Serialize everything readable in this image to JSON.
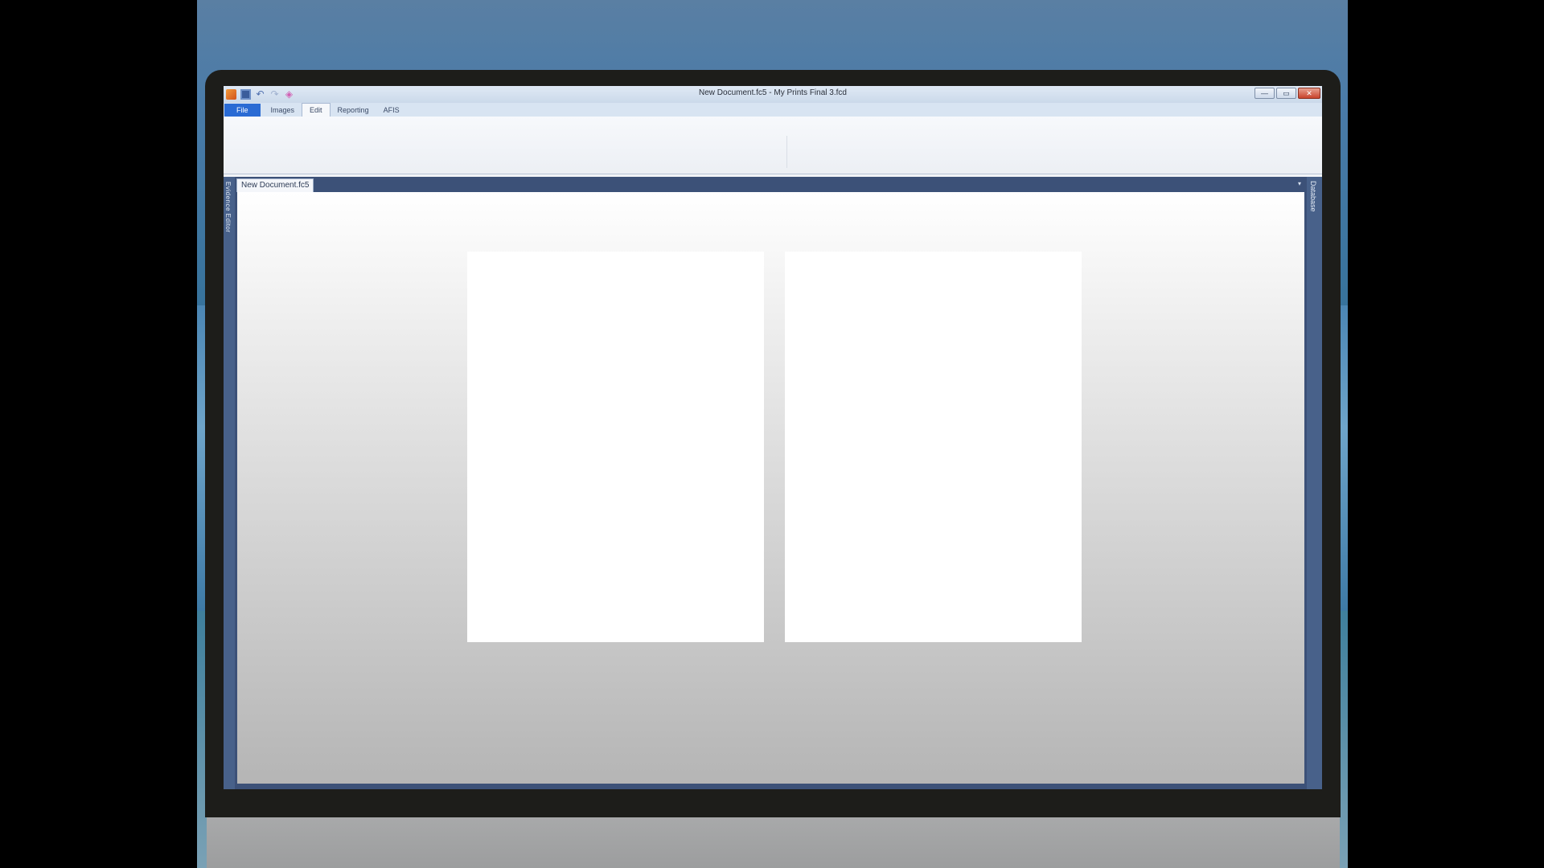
{
  "window": {
    "title": "New Document.fc5 - My Prints Final 3.fcd",
    "controls": {
      "minimize": "—",
      "maximize": "▭",
      "close": "✕"
    }
  },
  "quick_access": {
    "icons": [
      "app-icon",
      "save-icon",
      "undo-icon",
      "redo-icon",
      "extra-icon"
    ],
    "undo_glyph": "↶",
    "redo_glyph": "↷",
    "extra_glyph": "◈"
  },
  "ribbon_tabs": [
    {
      "label": "File"
    },
    {
      "label": "Images"
    },
    {
      "label": "Edit"
    },
    {
      "label": "Reporting"
    },
    {
      "label": "AFIS"
    }
  ],
  "active_tab": "Edit",
  "document": {
    "tab_label": "New Document.fc5",
    "dropdown_glyph": "▾"
  },
  "side_panels": {
    "left_label": "Evidence Editor",
    "right_label": "Database"
  },
  "colors": {
    "file_tab": "#2a6bd4",
    "workspace_frame": "#3c5178"
  }
}
